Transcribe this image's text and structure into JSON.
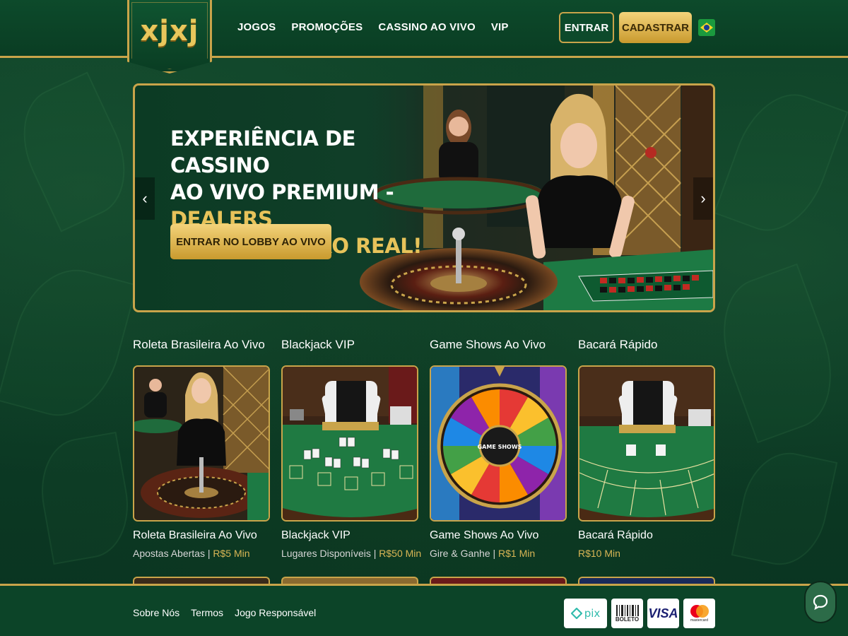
{
  "header": {
    "logo": "xjxj",
    "nav": [
      "JOGOS",
      "PROMOÇÕES",
      "CASSINO AO VIVO",
      "VIP"
    ],
    "login_label": "ENTRAR",
    "signup_label": "CADASTRAR",
    "flag_icon": "brazil-flag-icon"
  },
  "hero": {
    "title_line1": "EXPERIÊNCIA DE CASSINO",
    "title_line2_plain": "AO VIVO PREMIUM - ",
    "title_line2_gold": "DEALERS",
    "title_line3_gold": "REAIS, EMOÇÃO REAL!",
    "cta_label": "ENTRAR NO LOBBY AO VIVO",
    "prev_icon": "chevron-left-icon",
    "next_icon": "chevron-right-icon"
  },
  "games": [
    {
      "section_title": "Roleta Brasileira Ao Vivo",
      "name": "Roleta Brasileira Ao Vivo",
      "status": "Apostas Abertas | ",
      "price": "R$5 Min"
    },
    {
      "section_title": "Blackjack VIP",
      "name": "Blackjack VIP",
      "status": "Lugares Disponíveis | ",
      "price": "R$50 Min"
    },
    {
      "section_title": "Game Shows Ao Vivo",
      "name": "Game Shows Ao Vivo",
      "status": "Gire & Ganhe | ",
      "price": "R$1 Min"
    },
    {
      "section_title": "Bacará Rápido",
      "name": "Bacará Rápido",
      "status": "",
      "price": "R$10 Min"
    }
  ],
  "wheel_label": "GAME SHOWS",
  "footer": {
    "links": [
      "Sobre Nós",
      "Termos",
      "Jogo Responsável"
    ],
    "payments": {
      "pix": "pix",
      "boleto": "BOLETO",
      "visa": "VISA",
      "mastercard": "mastercard"
    },
    "chat_icon": "chat-bubble-icon"
  },
  "colors": {
    "gold": "#c9a44a",
    "gold_text": "#e7c35a",
    "green_bg": "#0b3a24"
  }
}
